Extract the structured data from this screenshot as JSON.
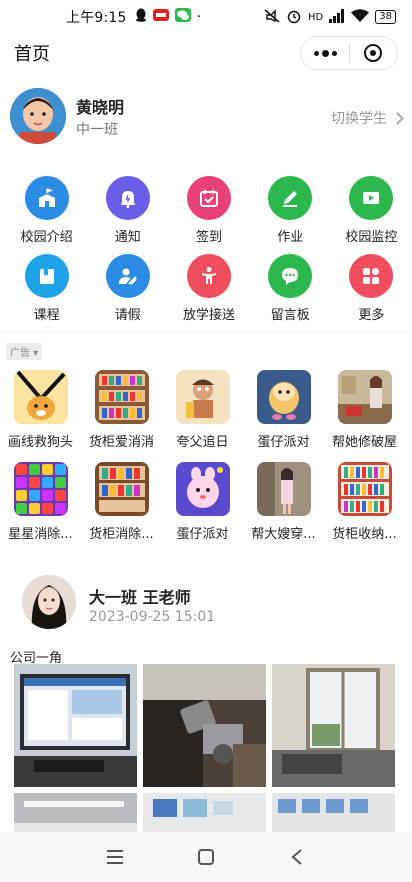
{
  "status_bar": {
    "time": "上午9:15",
    "signal": "HD",
    "battery": "38",
    "dot": "·"
  },
  "header": {
    "title": "首页"
  },
  "student": {
    "name": "黄晓明",
    "class": "中一班",
    "switch_label": "切换学生"
  },
  "menu": [
    {
      "label": "校园介绍",
      "icon": "school-icon",
      "color": "#2b8ce6"
    },
    {
      "label": "通知",
      "icon": "bell-icon",
      "color": "#6b5ce7"
    },
    {
      "label": "签到",
      "icon": "calendar-check-icon",
      "color": "#e8417a"
    },
    {
      "label": "作业",
      "icon": "pencil-icon",
      "color": "#2cb84c"
    },
    {
      "label": "校园监控",
      "icon": "video-icon",
      "color": "#2cb84c"
    },
    {
      "label": "课程",
      "icon": "book-icon",
      "color": "#1fa3e8"
    },
    {
      "label": "请假",
      "icon": "leave-icon",
      "color": "#2b8ce6"
    },
    {
      "label": "放学接送",
      "icon": "person-icon",
      "color": "#f04e5e"
    },
    {
      "label": "留言板",
      "icon": "chat-icon",
      "color": "#2cb84c"
    },
    {
      "label": "更多",
      "icon": "grid-icon",
      "color": "#f04e5e"
    }
  ],
  "ad": {
    "tag": "广告",
    "games": [
      {
        "label": "画线救狗头"
      },
      {
        "label": "货柜爱消消"
      },
      {
        "label": "夸父追日"
      },
      {
        "label": "蛋仔派对"
      },
      {
        "label": "帮她修破屋"
      },
      {
        "label": "星星消除..."
      },
      {
        "label": "货柜消除..."
      },
      {
        "label": "蛋仔派对"
      },
      {
        "label": "帮大嫂穿..."
      },
      {
        "label": "货柜收纳..."
      }
    ]
  },
  "post": {
    "author": "大一班 王老师",
    "time": "2023-09-25 15:01",
    "text": "公司一角"
  }
}
